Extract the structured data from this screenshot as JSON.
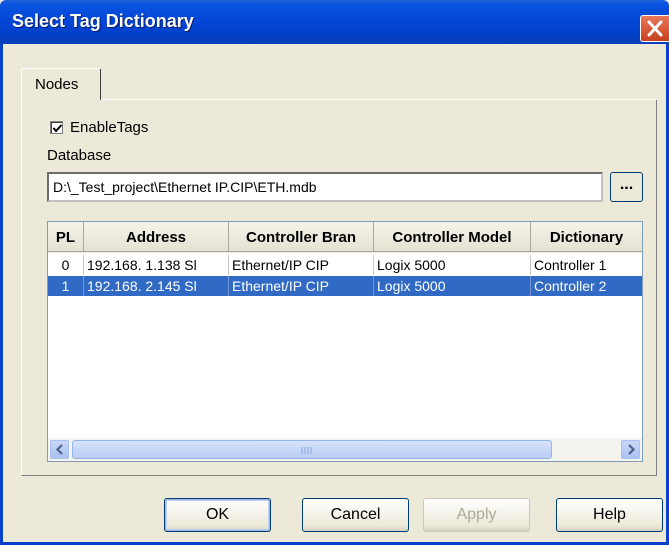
{
  "window": {
    "title": "Select Tag Dictionary"
  },
  "tabs": [
    {
      "label": "Nodes"
    }
  ],
  "enable_tags": {
    "label": "EnableTags",
    "checked": true
  },
  "database": {
    "label": "Database",
    "value": "D:\\_Test_project\\Ethernet IP.CIP\\ETH.mdb",
    "browse_label": "..."
  },
  "table": {
    "columns": [
      "PL",
      "Address",
      "Controller Bran",
      "Controller Model",
      "Dictionary"
    ],
    "rows": [
      {
        "pl": "0",
        "address": "192.168.  1.138 Sl",
        "brand": "Ethernet/IP CIP",
        "model": "Logix 5000",
        "dictionary": "Controller 1",
        "selected": false
      },
      {
        "pl": "1",
        "address": "192.168.  2.145 Sl",
        "brand": "Ethernet/IP CIP",
        "model": "Logix 5000",
        "dictionary": "Controller 2",
        "selected": true
      }
    ]
  },
  "buttons": {
    "ok": "OK",
    "cancel": "Cancel",
    "apply": "Apply",
    "help": "Help"
  },
  "colors": {
    "title_bar": "#0245d6",
    "selection": "#316ac5",
    "close_button": "#c6401e"
  },
  "icons": {
    "close": "close-icon",
    "check": "checkmark-icon",
    "scroll_left": "arrow-left-icon",
    "scroll_right": "arrow-right-icon"
  }
}
